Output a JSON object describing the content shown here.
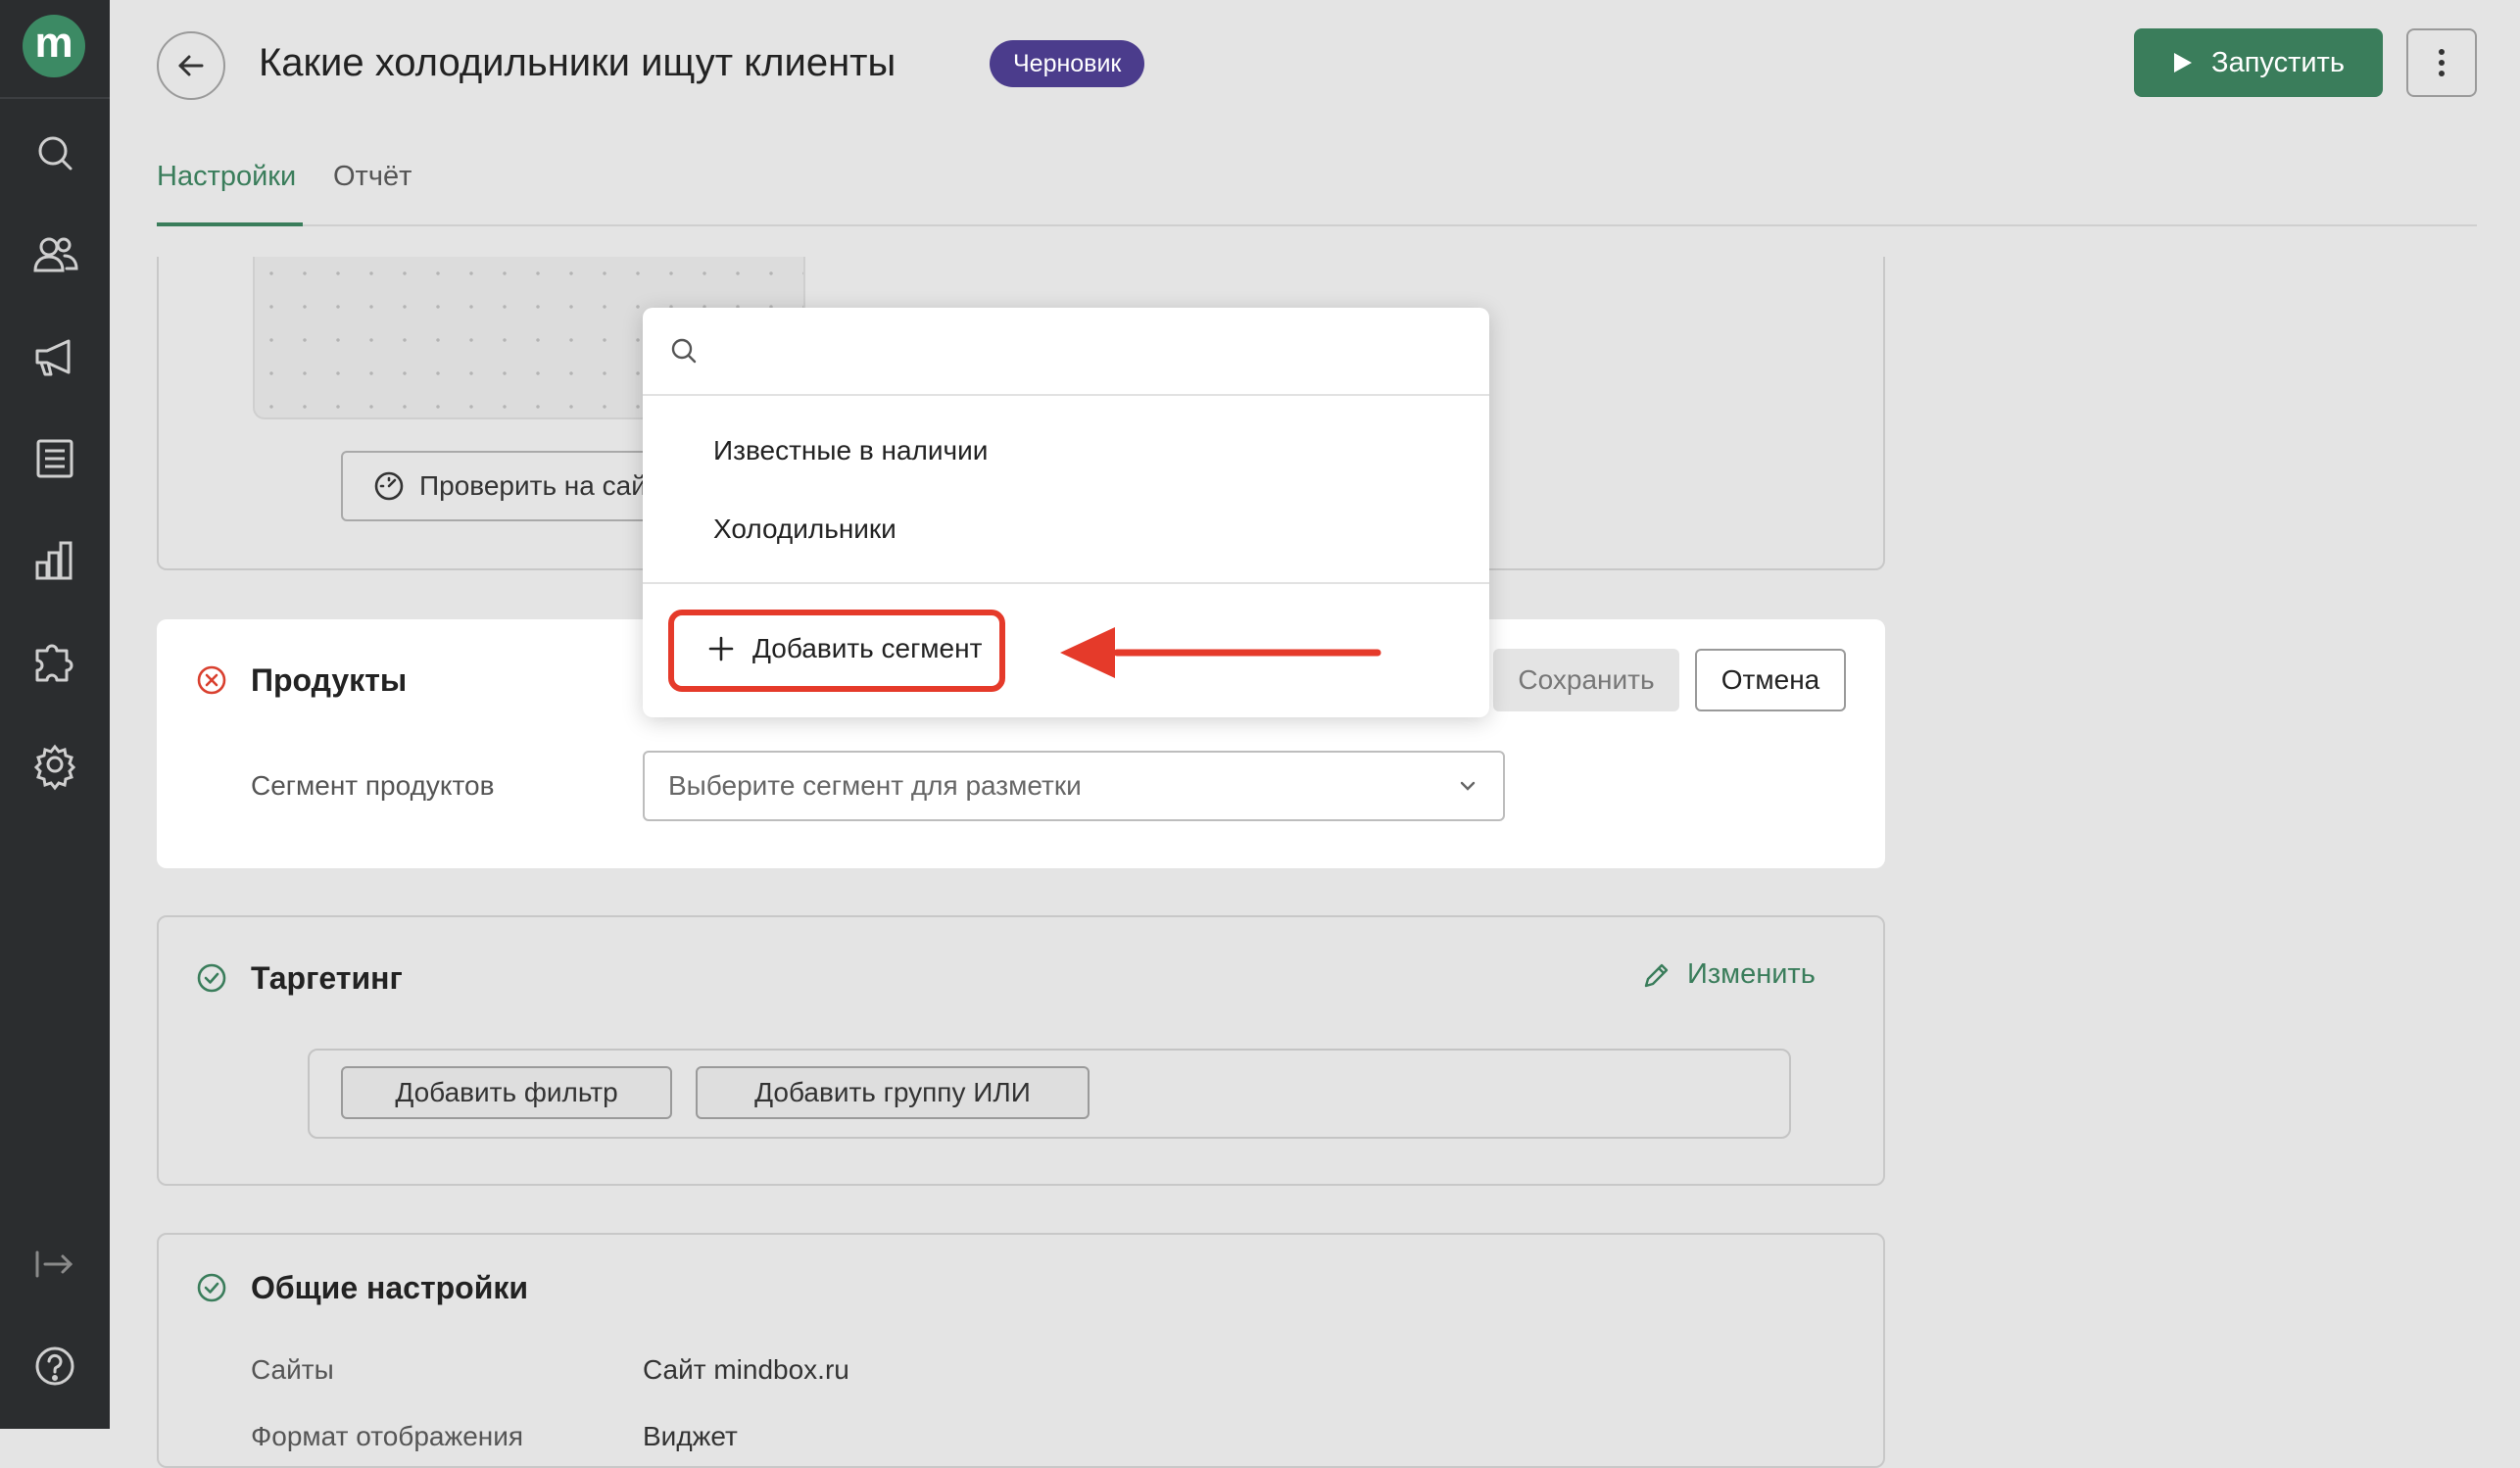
{
  "app": {
    "logo_letter": "m"
  },
  "header": {
    "title": "Какие холодильники ищут клиенты",
    "status_badge": "Черновик",
    "run_button": "Запустить"
  },
  "tabs": [
    {
      "label": "Настройки",
      "active": true
    },
    {
      "label": "Отчёт",
      "active": false
    }
  ],
  "preview": {
    "check_button": "Проверить на сайте"
  },
  "products": {
    "title": "Продукты",
    "segment_label": "Сегмент продуктов",
    "segment_placeholder": "Выберите сегмент для разметки",
    "save_button": "Сохранить",
    "cancel_button": "Отмена"
  },
  "dropdown": {
    "search_placeholder": "",
    "options": [
      "Известные в наличии",
      "Холодильники"
    ],
    "add_segment": "Добавить сегмент"
  },
  "targeting": {
    "title": "Таргетинг",
    "edit_link": "Изменить",
    "add_filter": "Добавить фильтр",
    "add_or_group": "Добавить группу ИЛИ"
  },
  "general": {
    "title": "Общие настройки",
    "rows": [
      {
        "label": "Сайты",
        "value": "Сайт mindbox.ru"
      },
      {
        "label": "Формат отображения",
        "value": "Виджет"
      }
    ]
  },
  "colors": {
    "accent_green": "#3a7d5b",
    "badge_purple": "#4b3c8c",
    "highlight_red": "#e53a2a",
    "sidebar_bg": "#2b2d2f"
  },
  "icons": {
    "sidebar": [
      "search-icon",
      "users-icon",
      "megaphone-icon",
      "document-icon",
      "bar-chart-icon",
      "puzzle-icon",
      "gear-icon",
      "collapse-icon",
      "help-icon"
    ]
  }
}
